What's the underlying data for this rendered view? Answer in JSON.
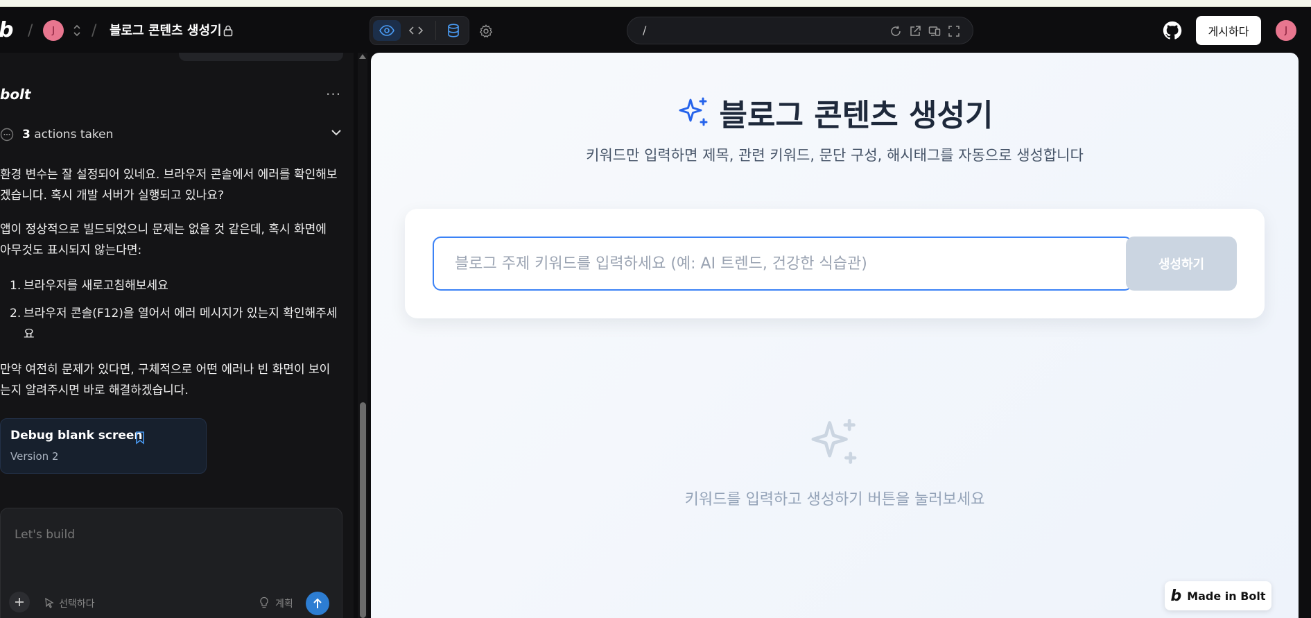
{
  "topbar": {
    "logo": "b",
    "avatar_initial": "J",
    "project_title": "블로그 콘텐츠 생성기",
    "url_path": "/",
    "publish_label": "게시하다",
    "user_avatar_initial": "J",
    "slash": "/"
  },
  "sidebar": {
    "bolt_label": "bolt",
    "more_label": "···",
    "actions_count": "3",
    "actions_text": "actions taken",
    "message1_line1": "환경 변수는 잘 설정되어 있네요. 브라우저 콘솔에서 에러를 확인해보",
    "message1_line2": "겠습니다. 혹시 개발 서버가 실행되고 있나요?",
    "message2_line1": "앱이 정상적으로 빌드되었으니 문제는 없을 것 같은데, 혹시 화면에",
    "message2_line2": "아무것도 표시되지 않는다면:",
    "list_item1_num": "1.",
    "list_item1": "브라우저를 새로고침해보세요",
    "list_item2_num": "2.",
    "list_item2_line1": "브라우저 콘솔(F12)을 열어서 에러 메시지가 있는지 확인해주세",
    "list_item2_line2": "요",
    "message3_line1": "만약 여전히 문제가 있다면, 구체적으로 어떤 에러나 빈 화면이 보이",
    "message3_line2": "는지 알려주시면 바로 해결하겠습니다.",
    "version_card": {
      "title": "Debug blank screen",
      "version": "Version 2"
    },
    "composer": {
      "placeholder": "Let's build",
      "select_label": "선택하다",
      "plan_label": "계획"
    }
  },
  "preview": {
    "title": "블로그 콘텐츠 생성기",
    "subtitle": "키워드만 입력하면 제목, 관련 키워드, 문단 구성, 해시태그를 자동으로 생성합니다",
    "input_placeholder": "블로그 주제 키워드를 입력하세요 (예: AI 트렌드, 건강한 식습관)",
    "generate_label": "생성하기",
    "empty_text": "키워드를 입력하고 생성하기 버튼을 눌러보세요",
    "made_in": "Made in Bolt"
  },
  "colors": {
    "accent": "#3b82f6",
    "button_disabled": "#cbd5e1",
    "send": "#2d7dd2"
  }
}
